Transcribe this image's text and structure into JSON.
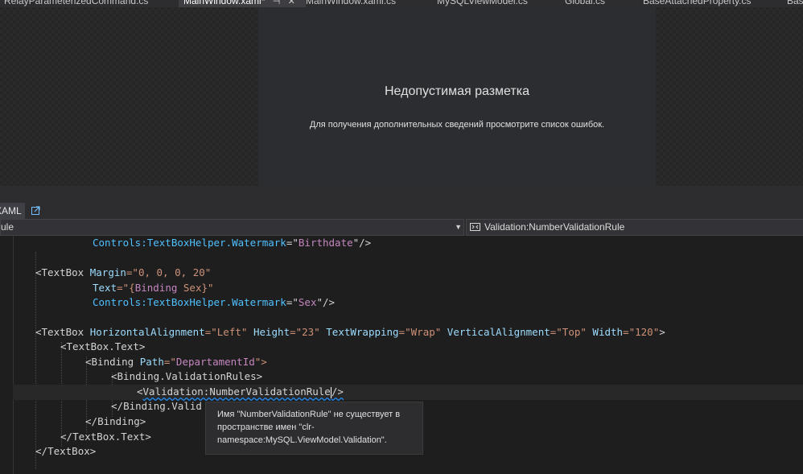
{
  "tabs": [
    {
      "label": "RelayParameterizedCommand.cs",
      "active": false
    },
    {
      "label": "MainWindow.xaml*",
      "active": true
    },
    {
      "label": "MainWindow.xaml.cs",
      "active": false
    },
    {
      "label": "MySQLViewModel.cs",
      "active": false
    },
    {
      "label": "Global.cs",
      "active": false
    },
    {
      "label": "BaseAttachedProperty.cs",
      "active": false
    },
    {
      "label": "Base",
      "active": false
    }
  ],
  "tab_icons": {
    "pin": "pin-icon",
    "close": "close-icon"
  },
  "designer": {
    "title": "Недопустимая разметка",
    "description": "Для получения дополнительных сведений просмотрите список ошибок."
  },
  "xaml_pane": {
    "tab_label": "XAML",
    "popout_icon": "popout-icon"
  },
  "nav": {
    "left_value": "ule",
    "right_value": "Validation:NumberValidationRule",
    "right_icon": "element-icon"
  },
  "code": {
    "lines": [
      [
        "Controls:TextBoxHelper.Watermark",
        "=\"",
        "Birthdate",
        "\"/>"
      ],
      [],
      [
        "<",
        "TextBox",
        " Margin",
        "=\"0, 0, 0, 20\""
      ],
      [
        "Text",
        "=\"{",
        "Binding",
        " Sex",
        "}\""
      ],
      [
        "Controls:TextBoxHelper.Watermark",
        "=\"",
        "Sex",
        "\"/>"
      ],
      [],
      [
        "<",
        "TextBox",
        " HorizontalAlignment",
        "=\"Left\"",
        " Height",
        "=\"23\"",
        " TextWrapping",
        "=\"Wrap\"",
        " VerticalAlignment",
        "=\"Top\"",
        " Width",
        "=\"120\"",
        ">"
      ],
      [
        "<",
        "TextBox.Text",
        ">"
      ],
      [
        "<",
        "Binding",
        " Path",
        "=\"",
        "DepartamentId",
        "\">"
      ],
      [
        "<",
        "Binding.ValidationRules",
        ">"
      ],
      [
        "<",
        "Validation:NumberValidationRule",
        "/>"
      ],
      [
        "</",
        "Binding.Valid"
      ],
      [
        "</",
        "Binding",
        ">"
      ],
      [
        "</",
        "TextBox.Text",
        ">"
      ],
      [
        "</",
        "TextBox",
        ">"
      ]
    ]
  },
  "tooltip": {
    "text": "Имя \"NumberValidationRule\" не существует в пространстве имен \"clr-namespace:MySQL.ViewModel.Validation\"."
  },
  "colors": {
    "editor_bg": "#1e1e1e",
    "keyword": "#569cd6",
    "attribute": "#9cdcfe",
    "string": "#ce9178",
    "markup_extension": "#c586c0",
    "squiggle": "#1e90ff"
  }
}
